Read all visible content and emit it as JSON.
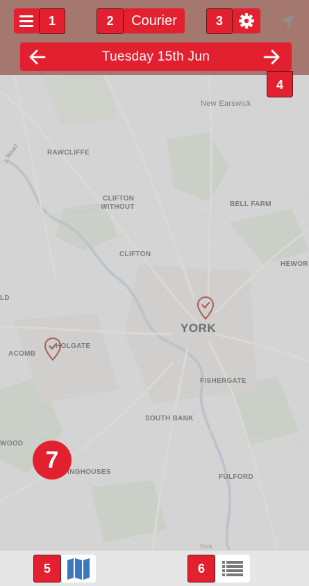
{
  "app": {
    "title": "Courier",
    "date_label": "Tuesday 15th Jun"
  },
  "badges": {
    "menu": "1",
    "title": "2",
    "settings": "3",
    "date_next": "4",
    "map_view": "5",
    "list_view": "6",
    "map_area": "7"
  },
  "map": {
    "labels": {
      "new_earswick": "New Earswick",
      "rawcliffe": "RAWCLIFFE",
      "clifton_without_1": "CLIFTON",
      "clifton_without_2": "WITHOUT",
      "bell_farm": "BELL FARM",
      "clifton": "CLIFTON",
      "heworth": "HEWOR",
      "york": "YORK",
      "acomb": "ACOMB",
      "holgate": "HOLGATE",
      "fishergate": "FISHERGATE",
      "south_bank": "SOUTH BANK",
      "dringhouses": "INGHOUSES",
      "fulford": "FULFORD",
      "wood": "WOOD",
      "ld": "LD",
      "road": "y Road",
      "york_bottom": "York"
    },
    "markers": [
      {
        "name": "delivery-marker-york"
      },
      {
        "name": "delivery-marker-holgate"
      }
    ]
  },
  "icons": {
    "menu": "hamburger-icon",
    "settings": "gear-icon",
    "location": "location-arrow-icon",
    "prev": "arrow-left-icon",
    "next": "arrow-right-icon",
    "map_view": "map-icon",
    "list_view": "list-icon"
  },
  "colors": {
    "accent": "#e2202f",
    "header_overlay": "#a4776f",
    "marker": "#a5443d"
  }
}
